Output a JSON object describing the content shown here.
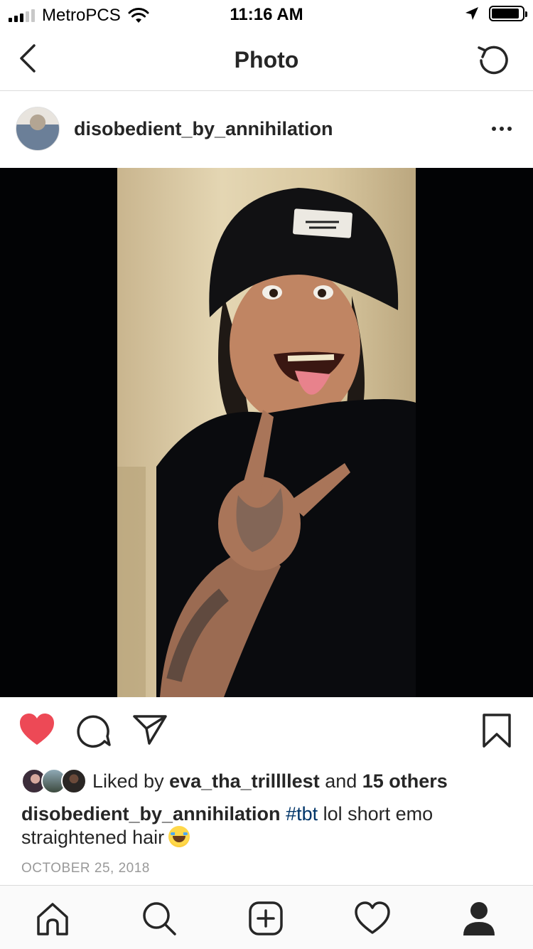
{
  "status_bar": {
    "carrier": "MetroPCS",
    "time": "11:16 AM",
    "signal_bars_filled": 3,
    "signal_bars_total": 5,
    "battery_level": 0.9
  },
  "nav": {
    "title": "Photo",
    "back_icon": "chevron-left-icon",
    "refresh_icon": "refresh-icon"
  },
  "post": {
    "username": "disobedient_by_annihilation",
    "more_icon": "more-horizontal-icon"
  },
  "actions": {
    "liked": true,
    "like_color": "#ed4956",
    "icons": [
      "heart-icon",
      "comment-icon",
      "share-icon",
      "bookmark-icon"
    ]
  },
  "likes": {
    "prefix": "Liked by ",
    "user": "eva_tha_trillllest",
    "middle": " and ",
    "others": "15 others"
  },
  "caption": {
    "username": "disobedient_by_annihilation",
    "hashtag": "#tbt",
    "text": " lol short emo straightened hair",
    "hashtag_color": "#003569"
  },
  "date": "OCTOBER 25, 2018",
  "tabbar": {
    "icons": [
      "home-icon",
      "search-icon",
      "add-post-icon",
      "activity-heart-icon",
      "profile-icon"
    ]
  }
}
